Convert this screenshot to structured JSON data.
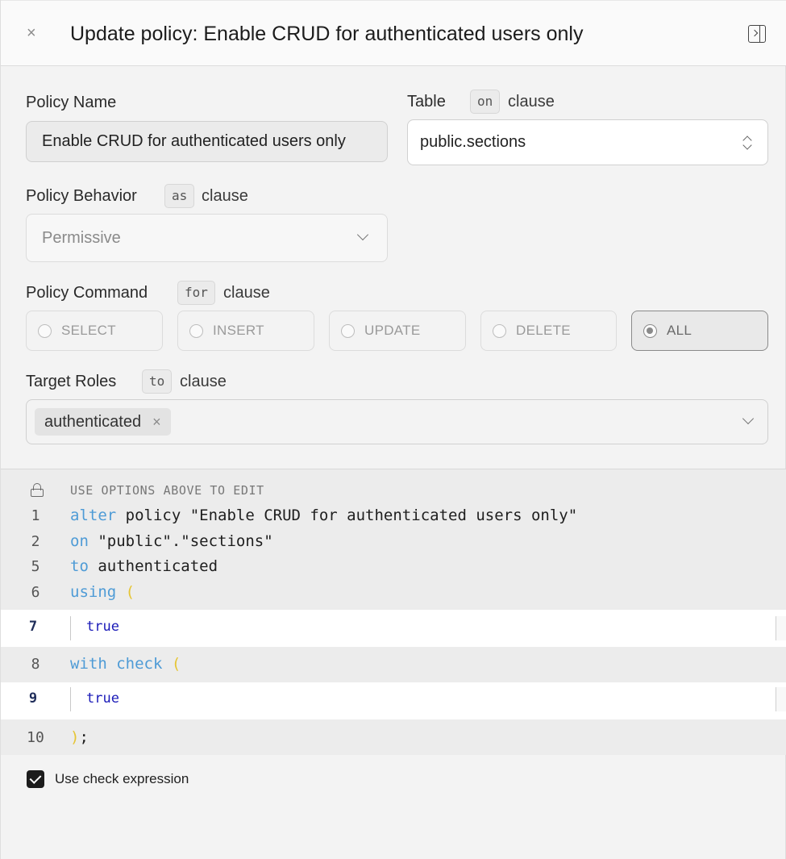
{
  "header": {
    "title": "Update policy: Enable CRUD for authenticated users only",
    "close_icon": "×"
  },
  "form": {
    "policy_name": {
      "label": "Policy Name",
      "value": "Enable CRUD for authenticated users only"
    },
    "table": {
      "label": "Table",
      "chip": "on",
      "clause": "clause",
      "value": "public.sections"
    },
    "behavior": {
      "label": "Policy Behavior",
      "chip": "as",
      "clause": "clause",
      "value": "Permissive"
    },
    "command": {
      "label": "Policy Command",
      "chip": "for",
      "clause": "clause",
      "options": [
        "SELECT",
        "INSERT",
        "UPDATE",
        "DELETE",
        "ALL"
      ],
      "selected": "ALL"
    },
    "roles": {
      "label": "Target Roles",
      "chip": "to",
      "clause": "clause",
      "tags": [
        "authenticated"
      ]
    }
  },
  "editor": {
    "hint": "USE OPTIONS ABOVE TO EDIT",
    "lines": [
      {
        "n": "1",
        "kw": "alter",
        "rest": " policy \"Enable CRUD for authenticated users only\""
      },
      {
        "n": "2",
        "kw": "on",
        "rest": " \"public\".\"sections\""
      },
      {
        "n": "5",
        "kw": "to",
        "rest": " authenticated"
      },
      {
        "n": "6",
        "kw": "using",
        "paren": "("
      },
      {
        "n": "7",
        "value": "true"
      },
      {
        "n": "8",
        "kw": "with check",
        "paren": "("
      },
      {
        "n": "9",
        "value": "true"
      },
      {
        "n": "10",
        "close": ");"
      }
    ]
  },
  "use_check": {
    "label": "Use check expression",
    "checked": true
  }
}
